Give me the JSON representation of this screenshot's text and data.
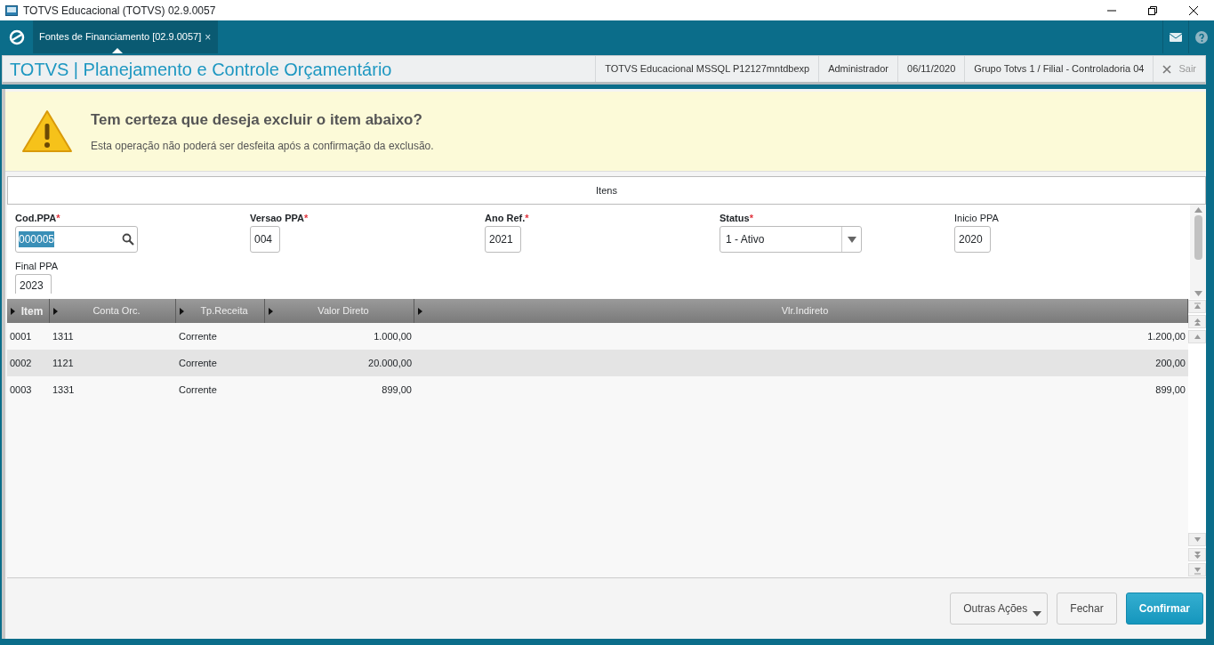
{
  "window": {
    "title": "TOTVS Educacional (TOTVS) 02.9.0057"
  },
  "tabs": [
    {
      "label": "Fontes de Financiamento [02.9.0057]",
      "selected": true,
      "close": "×"
    }
  ],
  "header": {
    "title": "TOTVS | Planejamento e Controle Orçamentário",
    "info": [
      "TOTVS Educacional MSSQL P12127mntdbexp",
      "Administrador",
      "06/11/2020",
      "Grupo Totvs 1 / Filial - Controladoria 04"
    ],
    "exit": "Sair"
  },
  "warning": {
    "title": "Tem certeza que deseja excluir o item abaixo?",
    "message": "Esta operação não poderá ser desfeita após a confirmação da exclusão."
  },
  "section": {
    "title": "Itens"
  },
  "fields": [
    {
      "label": "Cod.PPA",
      "required": true,
      "required_mark": "*",
      "kind": "lookup",
      "value": "000005",
      "text_selected": true
    },
    {
      "label": "Versao PPA",
      "required": true,
      "required_mark": "*",
      "kind": "text",
      "value": "004",
      "text_selected": false
    },
    {
      "label": "Ano Ref.",
      "required": true,
      "required_mark": "*",
      "kind": "text",
      "value": "2021",
      "text_selected": false
    },
    {
      "label": "Status",
      "required": true,
      "required_mark": "*",
      "kind": "select",
      "value": "1 - Ativo",
      "text_selected": false
    },
    {
      "label": "Inicio PPA",
      "required": false,
      "kind": "text",
      "value": "2020",
      "text_selected": false
    },
    {
      "label": "Final PPA",
      "required": false,
      "kind": "text",
      "value": "2023",
      "text_selected": false
    }
  ],
  "table": {
    "columns": [
      {
        "label": "Item",
        "kind": "text"
      },
      {
        "label": "Conta Orc.",
        "kind": "text"
      },
      {
        "label": "Tp.Receita",
        "kind": "text"
      },
      {
        "label": "Valor Direto",
        "kind": "number"
      },
      {
        "label": "Vlr.Indireto",
        "kind": "number"
      }
    ],
    "rows": [
      [
        "0001",
        "1311",
        "Corrente",
        "1.000,00",
        "1.200,00"
      ],
      [
        "0002",
        "1121",
        "Corrente",
        "20.000,00",
        "200,00"
      ],
      [
        "0003",
        "1331",
        "Corrente",
        "899,00",
        "899,00"
      ]
    ]
  },
  "buttons": [
    {
      "label": "Outras Ações",
      "kind": "menu"
    },
    {
      "label": "Fechar",
      "kind": "default"
    },
    {
      "label": "Confirmar",
      "kind": "primary"
    }
  ]
}
